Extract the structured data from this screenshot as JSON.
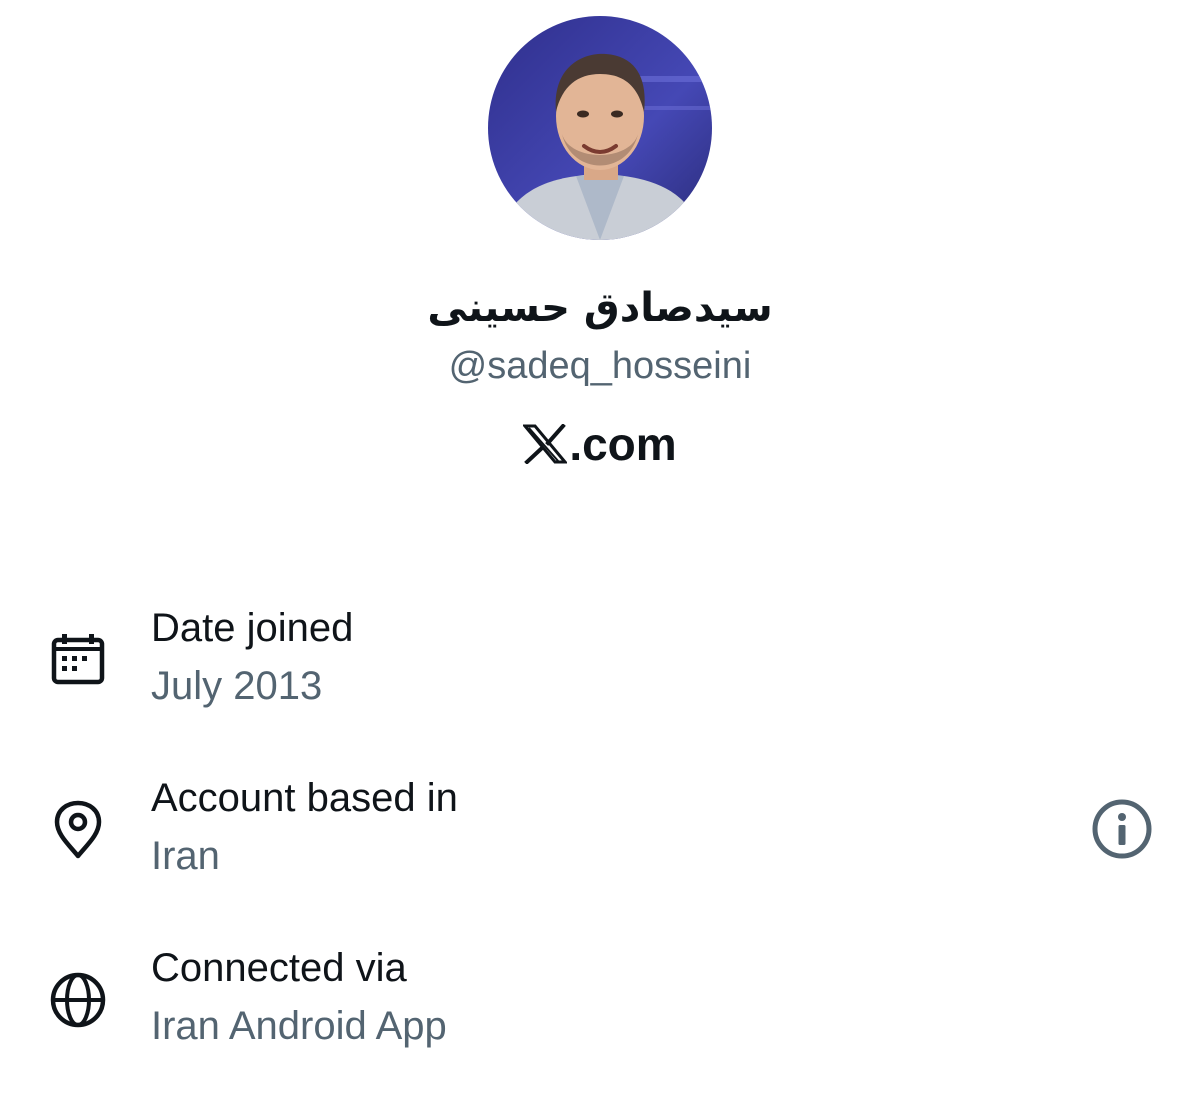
{
  "profile": {
    "display_name": "سیدصادق حسینی",
    "handle": "@sadeq_hosseini",
    "site_text": ".com"
  },
  "rows": [
    {
      "icon": "calendar-icon",
      "label": "Date joined",
      "value": "July 2013"
    },
    {
      "icon": "location-pin-icon",
      "label": "Account based in",
      "value": "Iran"
    },
    {
      "icon": "globe-icon",
      "label": "Connected via",
      "value": "Iran Android App"
    }
  ],
  "colors": {
    "primary_text": "#0f1419",
    "secondary_text": "#536471",
    "avatar_background": "#3b3fa0"
  }
}
